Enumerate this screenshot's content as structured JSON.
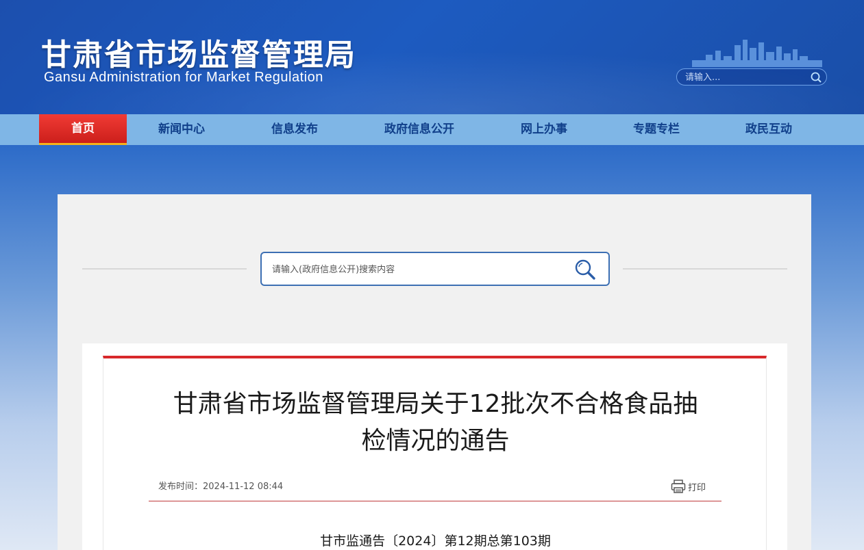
{
  "header": {
    "title_cn": "甘肃省市场监督管理局",
    "title_en": "Gansu Administration for Market Regulation",
    "search_placeholder": "请输入...",
    "search_icon": "search-icon",
    "skyline_icon": "city-skyline-icon"
  },
  "nav": {
    "items": [
      {
        "label": "首页",
        "active": true
      },
      {
        "label": "新闻中心"
      },
      {
        "label": "信息发布"
      },
      {
        "label": "政府信息公开"
      },
      {
        "label": "网上办事"
      },
      {
        "label": "专题专栏"
      },
      {
        "label": "政民互动"
      }
    ]
  },
  "gov_search": {
    "placeholder": "请输入(政府信息公开)搜索内容",
    "icon": "magnifier-icon"
  },
  "article": {
    "title_line1": "甘肃省市场监督管理局关于12批次不合格食品抽",
    "title_line2": "检情况的通告",
    "publish_label": "发布时间：",
    "publish_time": "2024-11-12 08:44",
    "print_label": "打印",
    "print_icon": "printer-icon",
    "doc_number": "甘市监通告〔2024〕第12期总第103期"
  },
  "colors": {
    "nav_bg": "#7fb6e6",
    "nav_active": "#e0302b",
    "nav_active_underline": "#f6b21a",
    "accent_red": "#d8282b",
    "search_border": "#3c6fb3"
  }
}
